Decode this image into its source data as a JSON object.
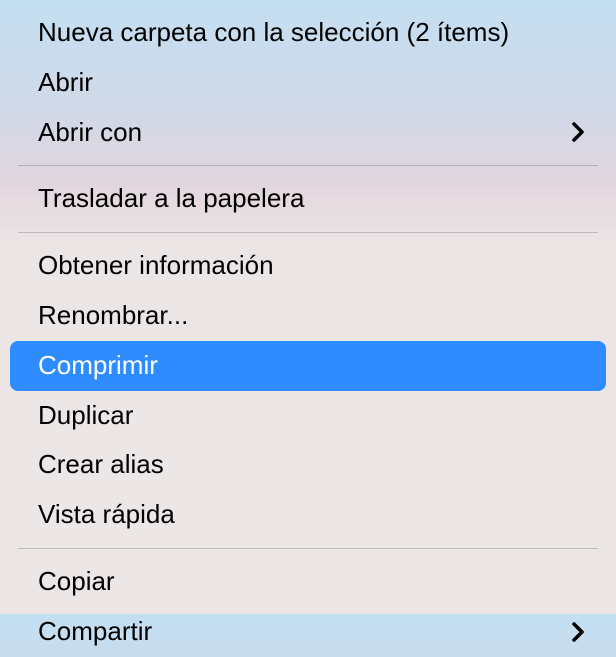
{
  "menu": {
    "items": [
      {
        "label": "Nueva carpeta con la selección (2 ítems)",
        "hasSubmenu": false,
        "highlighted": false
      },
      {
        "label": "Abrir",
        "hasSubmenu": false,
        "highlighted": false
      },
      {
        "label": "Abrir con",
        "hasSubmenu": true,
        "highlighted": false
      },
      {
        "separator": true
      },
      {
        "label": "Trasladar a la papelera",
        "hasSubmenu": false,
        "highlighted": false
      },
      {
        "separator": true
      },
      {
        "label": "Obtener información",
        "hasSubmenu": false,
        "highlighted": false
      },
      {
        "label": "Renombrar...",
        "hasSubmenu": false,
        "highlighted": false
      },
      {
        "label": "Comprimir",
        "hasSubmenu": false,
        "highlighted": true
      },
      {
        "label": "Duplicar",
        "hasSubmenu": false,
        "highlighted": false
      },
      {
        "label": "Crear alias",
        "hasSubmenu": false,
        "highlighted": false
      },
      {
        "label": "Vista rápida",
        "hasSubmenu": false,
        "highlighted": false
      },
      {
        "separator": true
      },
      {
        "label": "Copiar",
        "hasSubmenu": false,
        "highlighted": false
      },
      {
        "label": "Compartir",
        "hasSubmenu": true,
        "highlighted": false
      }
    ]
  }
}
